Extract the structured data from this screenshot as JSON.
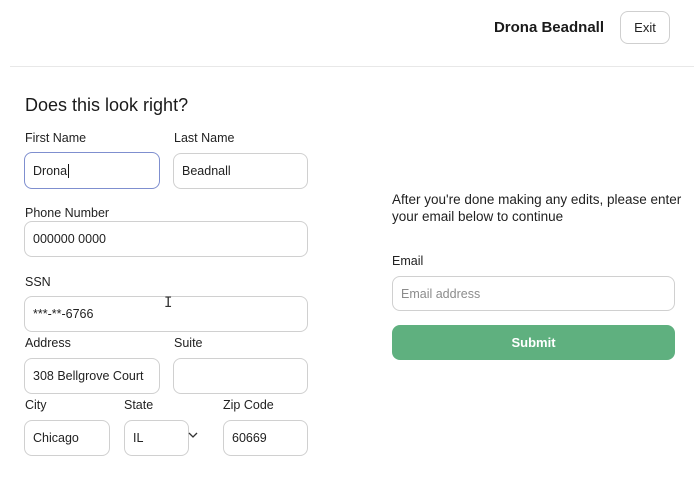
{
  "header": {
    "user_name": "Drona Beadnall",
    "exit_label": "Exit"
  },
  "form": {
    "title": "Does this look right?",
    "first_name": {
      "label": "First Name",
      "value": "Drona"
    },
    "last_name": {
      "label": "Last Name",
      "value": "Beadnall"
    },
    "phone": {
      "label": "Phone Number",
      "value": "000000 0000"
    },
    "ssn": {
      "label": "SSN",
      "value": "***-**-6766"
    },
    "address": {
      "label": "Address",
      "value": "308 Bellgrove Court"
    },
    "suite": {
      "label": "Suite",
      "value": ""
    },
    "city": {
      "label": "City",
      "value": "Chicago"
    },
    "state": {
      "label": "State",
      "value": "IL"
    },
    "zip": {
      "label": "Zip Code",
      "value": "60669"
    }
  },
  "side": {
    "instruction": "After you're done making any edits, please enter your email below to continue",
    "email_label": "Email",
    "email_placeholder": "Email address",
    "email_value": "",
    "submit_label": "Submit"
  },
  "colors": {
    "submit_bg": "#5fb07f",
    "focus_border": "#7f8fcf"
  },
  "icons": {
    "state_dropdown": "chevron-down-icon",
    "mouse_cursor": "text-cursor-icon"
  }
}
